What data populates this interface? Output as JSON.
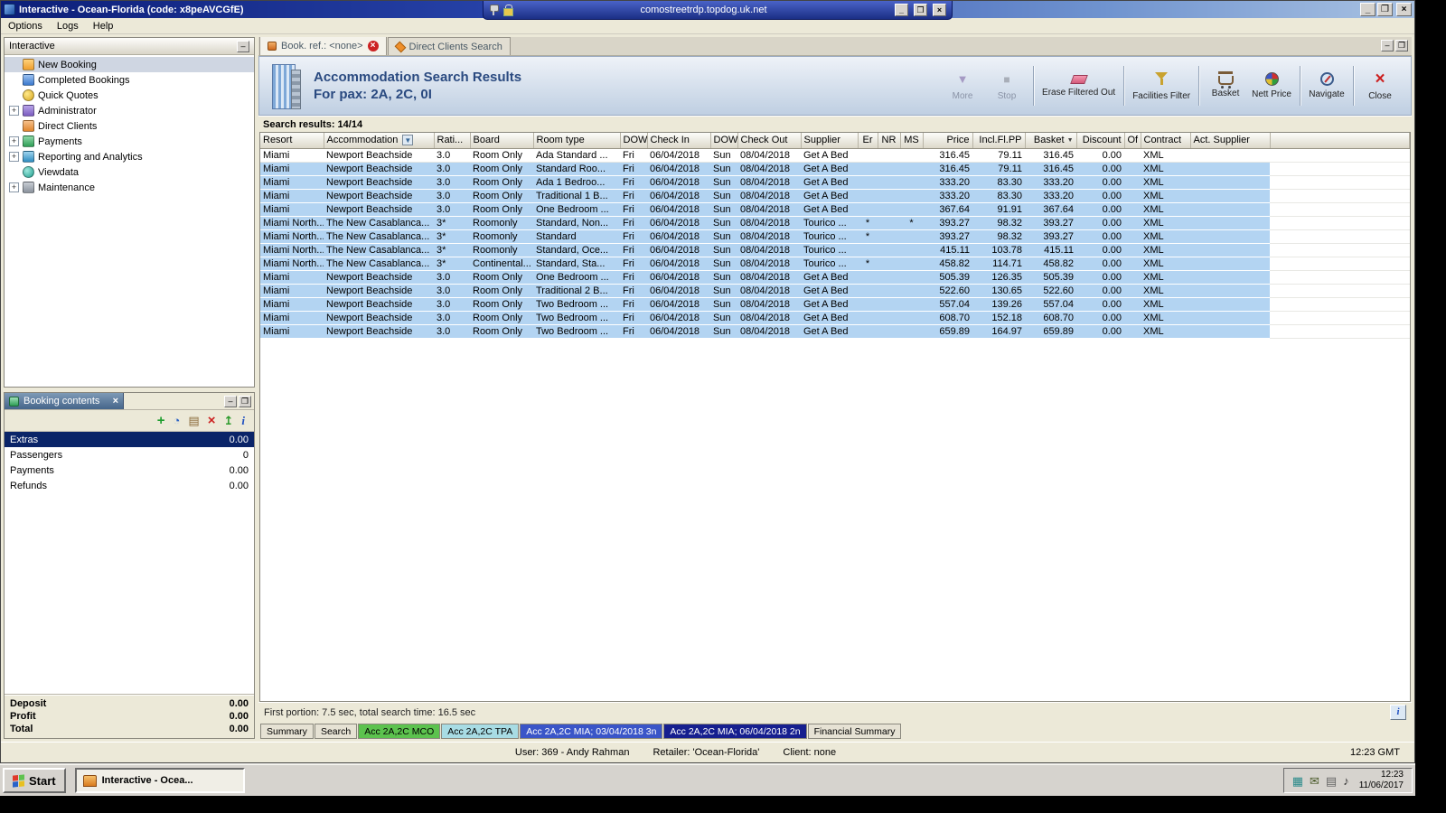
{
  "colors": {
    "selection": "#b3d4f2",
    "header_title": "#2a4a80",
    "tab_green": "#5cc24e",
    "tab_cyan": "#a8dce4",
    "tab_blue": "#3a55c8",
    "tab_navy": "#161f8f"
  },
  "window": {
    "title": "Interactive - Ocean-Florida (code: x8peAVCGfE)",
    "menu": [
      "Options",
      "Logs",
      "Help"
    ]
  },
  "rdp": {
    "host": "comostreetrdp.topdog.uk.net"
  },
  "sidebar": {
    "title": "Interactive",
    "items": [
      {
        "label": "New Booking",
        "selected": true
      },
      {
        "label": "Completed Bookings"
      },
      {
        "label": "Quick Quotes"
      },
      {
        "label": "Administrator",
        "expandable": true
      },
      {
        "label": "Direct Clients"
      },
      {
        "label": "Payments",
        "expandable": true
      },
      {
        "label": "Reporting and Analytics",
        "expandable": true
      },
      {
        "label": "Viewdata"
      },
      {
        "label": "Maintenance",
        "expandable": true
      }
    ]
  },
  "booking": {
    "title": "Booking contents",
    "toolbar": [
      {
        "name": "add-icon",
        "glyph": "+"
      },
      {
        "name": "history-icon",
        "glyph": "◔"
      },
      {
        "name": "basket-remove-icon",
        "glyph": "▤"
      },
      {
        "name": "delete-icon",
        "glyph": "×"
      },
      {
        "name": "palm-tree-icon",
        "glyph": "↥"
      },
      {
        "name": "info-icon",
        "glyph": "i"
      }
    ],
    "rows": [
      {
        "label": "Extras",
        "value": "0.00",
        "selected": true
      },
      {
        "label": "Passengers",
        "value": "0"
      },
      {
        "label": "Payments",
        "value": "0.00"
      },
      {
        "label": "Refunds",
        "value": "0.00"
      }
    ],
    "totals": [
      {
        "label": "Deposit",
        "value": "0.00"
      },
      {
        "label": "Profit",
        "value": "0.00"
      },
      {
        "label": "Total",
        "value": "0.00"
      }
    ]
  },
  "main": {
    "tabs": [
      {
        "label": "Book. ref.: <none>",
        "active": true,
        "closable": true
      },
      {
        "label": "Direct Clients Search"
      }
    ],
    "header": {
      "title": "Accommodation Search Results",
      "subtitle": "For pax: 2A, 2C, 0I"
    },
    "toolbar": [
      {
        "label": "More",
        "icon": "more",
        "disabled": true
      },
      {
        "label": "Stop",
        "icon": "stop",
        "disabled": true
      },
      {
        "sep": true
      },
      {
        "label": "Erase Filtered Out",
        "icon": "erase"
      },
      {
        "sep": true
      },
      {
        "label": "Facilities Filter",
        "icon": "filter"
      },
      {
        "sep": true
      },
      {
        "label": "Basket",
        "icon": "basket"
      },
      {
        "label": "Nett Price",
        "icon": "nett"
      },
      {
        "sep": true
      },
      {
        "label": "Navigate",
        "icon": "navigate"
      },
      {
        "sep": true
      },
      {
        "label": "Close",
        "icon": "close-x"
      }
    ],
    "results_label": "Search results: 14/14",
    "table": {
      "columns": [
        {
          "label": "Resort"
        },
        {
          "label": "Accommodation",
          "filter": true
        },
        {
          "label": "Rati..."
        },
        {
          "label": "Board"
        },
        {
          "label": "Room type"
        },
        {
          "label": "DOW"
        },
        {
          "label": "Check In"
        },
        {
          "label": "DOW"
        },
        {
          "label": "Check Out"
        },
        {
          "label": "Supplier"
        },
        {
          "label": "Er"
        },
        {
          "label": "NR"
        },
        {
          "label": "MS"
        },
        {
          "label": "Price"
        },
        {
          "label": "Incl.Fl.PP"
        },
        {
          "label": "Basket",
          "sort": true
        },
        {
          "label": "Discount"
        },
        {
          "label": "Of"
        },
        {
          "label": "Contract"
        },
        {
          "label": "Act. Supplier"
        }
      ],
      "rows": [
        {
          "selected": false,
          "cells": [
            "Miami",
            "Newport Beachside",
            "3.0",
            "Room Only",
            "Ada Standard ...",
            "Fri",
            "06/04/2018",
            "Sun",
            "08/04/2018",
            "Get A Bed",
            "",
            "",
            "",
            "316.45",
            "79.11",
            "316.45",
            "0.00",
            "",
            "XML",
            ""
          ]
        },
        {
          "selected": true,
          "cells": [
            "Miami",
            "Newport Beachside",
            "3.0",
            "Room Only",
            "Standard Roo...",
            "Fri",
            "06/04/2018",
            "Sun",
            "08/04/2018",
            "Get A Bed",
            "",
            "",
            "",
            "316.45",
            "79.11",
            "316.45",
            "0.00",
            "",
            "XML",
            ""
          ]
        },
        {
          "selected": true,
          "cells": [
            "Miami",
            "Newport Beachside",
            "3.0",
            "Room Only",
            "Ada 1 Bedroo...",
            "Fri",
            "06/04/2018",
            "Sun",
            "08/04/2018",
            "Get A Bed",
            "",
            "",
            "",
            "333.20",
            "83.30",
            "333.20",
            "0.00",
            "",
            "XML",
            ""
          ]
        },
        {
          "selected": true,
          "cells": [
            "Miami",
            "Newport Beachside",
            "3.0",
            "Room Only",
            "Traditional 1 B...",
            "Fri",
            "06/04/2018",
            "Sun",
            "08/04/2018",
            "Get A Bed",
            "",
            "",
            "",
            "333.20",
            "83.30",
            "333.20",
            "0.00",
            "",
            "XML",
            ""
          ]
        },
        {
          "selected": true,
          "cells": [
            "Miami",
            "Newport Beachside",
            "3.0",
            "Room Only",
            "One Bedroom ...",
            "Fri",
            "06/04/2018",
            "Sun",
            "08/04/2018",
            "Get A Bed",
            "",
            "",
            "",
            "367.64",
            "91.91",
            "367.64",
            "0.00",
            "",
            "XML",
            ""
          ]
        },
        {
          "selected": true,
          "cells": [
            "Miami North...",
            "The New Casablanca...",
            "3*",
            "Roomonly",
            "Standard, Non...",
            "Fri",
            "06/04/2018",
            "Sun",
            "08/04/2018",
            "Tourico ...",
            "*",
            "",
            "*",
            "393.27",
            "98.32",
            "393.27",
            "0.00",
            "",
            "XML",
            ""
          ]
        },
        {
          "selected": true,
          "cells": [
            "Miami North...",
            "The New Casablanca...",
            "3*",
            "Roomonly",
            "Standard",
            "Fri",
            "06/04/2018",
            "Sun",
            "08/04/2018",
            "Tourico ...",
            "*",
            "",
            "",
            "393.27",
            "98.32",
            "393.27",
            "0.00",
            "",
            "XML",
            ""
          ]
        },
        {
          "selected": true,
          "cells": [
            "Miami North...",
            "The New Casablanca...",
            "3*",
            "Roomonly",
            "Standard, Oce...",
            "Fri",
            "06/04/2018",
            "Sun",
            "08/04/2018",
            "Tourico ...",
            "",
            "",
            "",
            "415.11",
            "103.78",
            "415.11",
            "0.00",
            "",
            "XML",
            ""
          ]
        },
        {
          "selected": true,
          "cells": [
            "Miami North...",
            "The New Casablanca...",
            "3*",
            "Continental...",
            "Standard, Sta...",
            "Fri",
            "06/04/2018",
            "Sun",
            "08/04/2018",
            "Tourico ...",
            "*",
            "",
            "",
            "458.82",
            "114.71",
            "458.82",
            "0.00",
            "",
            "XML",
            ""
          ]
        },
        {
          "selected": true,
          "cells": [
            "Miami",
            "Newport Beachside",
            "3.0",
            "Room Only",
            "One Bedroom ...",
            "Fri",
            "06/04/2018",
            "Sun",
            "08/04/2018",
            "Get A Bed",
            "",
            "",
            "",
            "505.39",
            "126.35",
            "505.39",
            "0.00",
            "",
            "XML",
            ""
          ]
        },
        {
          "selected": true,
          "cells": [
            "Miami",
            "Newport Beachside",
            "3.0",
            "Room Only",
            "Traditional 2 B...",
            "Fri",
            "06/04/2018",
            "Sun",
            "08/04/2018",
            "Get A Bed",
            "",
            "",
            "",
            "522.60",
            "130.65",
            "522.60",
            "0.00",
            "",
            "XML",
            ""
          ]
        },
        {
          "selected": true,
          "cells": [
            "Miami",
            "Newport Beachside",
            "3.0",
            "Room Only",
            "Two Bedroom ...",
            "Fri",
            "06/04/2018",
            "Sun",
            "08/04/2018",
            "Get A Bed",
            "",
            "",
            "",
            "557.04",
            "139.26",
            "557.04",
            "0.00",
            "",
            "XML",
            ""
          ]
        },
        {
          "selected": true,
          "cells": [
            "Miami",
            "Newport Beachside",
            "3.0",
            "Room Only",
            "Two Bedroom ...",
            "Fri",
            "06/04/2018",
            "Sun",
            "08/04/2018",
            "Get A Bed",
            "",
            "",
            "",
            "608.70",
            "152.18",
            "608.70",
            "0.00",
            "",
            "XML",
            ""
          ]
        },
        {
          "selected": true,
          "cells": [
            "Miami",
            "Newport Beachside",
            "3.0",
            "Room Only",
            "Two Bedroom ...",
            "Fri",
            "06/04/2018",
            "Sun",
            "08/04/2018",
            "Get A Bed",
            "",
            "",
            "",
            "659.89",
            "164.97",
            "659.89",
            "0.00",
            "",
            "XML",
            ""
          ]
        }
      ]
    },
    "status_line": "First portion: 7.5 sec, total search time: 16.5 sec",
    "bottom_tabs": [
      {
        "label": "Summary",
        "style": "plain"
      },
      {
        "label": "Search",
        "style": "plain"
      },
      {
        "label": "Acc 2A,2C MCO",
        "style": "green"
      },
      {
        "label": "Acc 2A,2C TPA",
        "style": "cyan"
      },
      {
        "label": "Acc 2A,2C MIA; 03/04/2018 3n",
        "style": "blue"
      },
      {
        "label": "Acc 2A,2C MIA; 06/04/2018 2n",
        "style": "navy",
        "active": true
      },
      {
        "label": "Financial Summary",
        "style": "plain"
      }
    ]
  },
  "statusbar": {
    "user": "User: 369 - Andy Rahman",
    "retailer": "Retailer: 'Ocean-Florida'",
    "client": "Client: none",
    "time": "12:23 GMT"
  },
  "taskbar": {
    "start_label": "Start",
    "task_label": "Interactive - Ocea...",
    "tray_icons": [
      {
        "name": "network-status-icon",
        "glyph": "▦",
        "color": "#2a8a8a"
      },
      {
        "name": "mail-icon",
        "glyph": "✉",
        "color": "#4a5a2a"
      },
      {
        "name": "printer-icon",
        "glyph": "▤",
        "color": "#666666"
      },
      {
        "name": "volume-icon",
        "glyph": "♪",
        "color": "#333333"
      }
    ],
    "clock_time": "12:23",
    "clock_date": "11/06/2017"
  }
}
